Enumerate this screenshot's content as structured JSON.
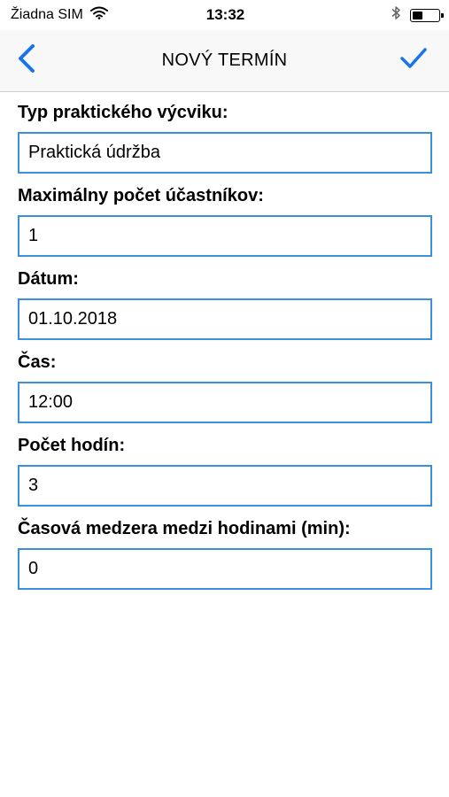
{
  "status_bar": {
    "carrier": "Žiadna SIM",
    "time": "13:32"
  },
  "nav": {
    "title": "NOVÝ TERMÍN",
    "accent_color": "#1a73e8"
  },
  "form": {
    "fields": [
      {
        "label": "Typ praktického výcviku:",
        "value": "Praktická údržba"
      },
      {
        "label": "Maximálny počet účastníkov:",
        "value": "1"
      },
      {
        "label": "Dátum:",
        "value": "01.10.2018"
      },
      {
        "label": "Čas:",
        "value": "12:00"
      },
      {
        "label": "Počet hodín:",
        "value": "3"
      },
      {
        "label": "Časová medzera medzi hodinami (min):",
        "value": "0"
      }
    ]
  }
}
